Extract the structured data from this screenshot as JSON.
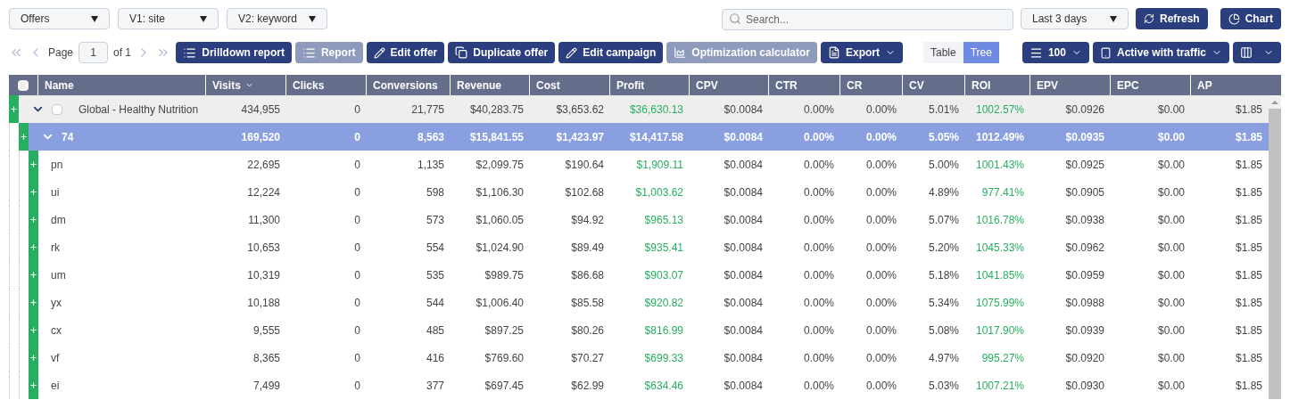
{
  "filters": [
    {
      "value": "Offers"
    },
    {
      "value": "V1: site"
    },
    {
      "value": "V2: keyword"
    }
  ],
  "search": {
    "placeholder": "Search..."
  },
  "date_range": {
    "value": "Last 3 days"
  },
  "top_buttons": [
    {
      "kind": "refresh",
      "label": "Refresh"
    },
    {
      "kind": "chart",
      "label": "Chart"
    }
  ],
  "pagination": {
    "label": "Page",
    "page": "1",
    "total": "of 1"
  },
  "actions": [
    {
      "kind": "list",
      "label": "Drilldown report",
      "disabled": false
    },
    {
      "kind": "list",
      "label": "Report",
      "disabled": true
    },
    {
      "kind": "edit",
      "label": "Edit offer",
      "disabled": false
    },
    {
      "kind": "copy",
      "label": "Duplicate offer",
      "disabled": false
    },
    {
      "kind": "edit",
      "label": "Edit campaign",
      "disabled": false
    },
    {
      "kind": "calc",
      "label": "Optimization calculator",
      "disabled": true
    },
    {
      "kind": "export",
      "label": "Export",
      "disabled": false
    }
  ],
  "view_toggle": [
    {
      "label": "Table",
      "selected": false
    },
    {
      "label": "Tree",
      "selected": true
    }
  ],
  "right_controls": [
    {
      "kind": "rows",
      "label": "100"
    },
    {
      "kind": "filter",
      "label": "Active with traffic"
    },
    {
      "kind": "columns"
    }
  ],
  "table": {
    "select_all": {
      "checked": false
    },
    "columns": [
      {
        "label": "Name",
        "kind": "text"
      },
      {
        "label": "Visits",
        "kind": "metric",
        "sorted": true
      },
      {
        "label": "Clicks",
        "kind": "metric"
      },
      {
        "label": "Conversions",
        "kind": "metric"
      },
      {
        "label": "Revenue",
        "kind": "metric"
      },
      {
        "label": "Cost",
        "kind": "metric"
      },
      {
        "label": "Profit",
        "kind": "gain"
      },
      {
        "label": "CPV",
        "kind": "metric"
      },
      {
        "label": "CTR",
        "kind": "metric"
      },
      {
        "label": "CR",
        "kind": "metric"
      },
      {
        "label": "CV",
        "kind": "metric"
      },
      {
        "label": "ROI",
        "kind": "gain"
      },
      {
        "label": "EPV",
        "kind": "metric"
      },
      {
        "label": "EPC",
        "kind": "metric"
      },
      {
        "label": "AP",
        "kind": "metric"
      }
    ],
    "rows": [
      {
        "kind": "group",
        "expanded": true,
        "selected": false,
        "checked": false,
        "cells": [
          "Global - Healthy Nutrition",
          "434,955",
          "0",
          "21,775",
          "$40,283.75",
          "$3,653.62",
          "$36,630.13",
          "$0.0084",
          "0.00%",
          "0.00%",
          "5.01%",
          "1002.57%",
          "$0.0926",
          "$0.00",
          "$1.85"
        ],
        "children": [
          {
            "kind": "subgroup",
            "expanded": true,
            "selected": true,
            "cells": [
              "74",
              "169,520",
              "0",
              "8,563",
              "$15,841.55",
              "$1,423.97",
              "$14,417.58",
              "$0.0084",
              "0.00%",
              "0.00%",
              "5.05%",
              "1012.49%",
              "$0.0935",
              "$0.00",
              "$1.85"
            ],
            "children": [
              {
                "kind": "leaf",
                "selected": false,
                "cells": [
                  "pn",
                  "22,695",
                  "0",
                  "1,135",
                  "$2,099.75",
                  "$190.64",
                  "$1,909.11",
                  "$0.0084",
                  "0.00%",
                  "0.00%",
                  "5.00%",
                  "1001.43%",
                  "$0.0925",
                  "$0.00",
                  "$1.85"
                ]
              },
              {
                "kind": "leaf",
                "selected": false,
                "cells": [
                  "ui",
                  "12,224",
                  "0",
                  "598",
                  "$1,106.30",
                  "$102.68",
                  "$1,003.62",
                  "$0.0084",
                  "0.00%",
                  "0.00%",
                  "4.89%",
                  "977.41%",
                  "$0.0905",
                  "$0.00",
                  "$1.85"
                ]
              },
              {
                "kind": "leaf",
                "selected": false,
                "cells": [
                  "dm",
                  "11,300",
                  "0",
                  "573",
                  "$1,060.05",
                  "$94.92",
                  "$965.13",
                  "$0.0084",
                  "0.00%",
                  "0.00%",
                  "5.07%",
                  "1016.78%",
                  "$0.0938",
                  "$0.00",
                  "$1.85"
                ]
              },
              {
                "kind": "leaf",
                "selected": false,
                "cells": [
                  "rk",
                  "10,653",
                  "0",
                  "554",
                  "$1,024.90",
                  "$89.49",
                  "$935.41",
                  "$0.0084",
                  "0.00%",
                  "0.00%",
                  "5.20%",
                  "1045.33%",
                  "$0.0962",
                  "$0.00",
                  "$1.85"
                ]
              },
              {
                "kind": "leaf",
                "selected": false,
                "cells": [
                  "um",
                  "10,319",
                  "0",
                  "535",
                  "$989.75",
                  "$86.68",
                  "$903.07",
                  "$0.0084",
                  "0.00%",
                  "0.00%",
                  "5.18%",
                  "1041.85%",
                  "$0.0959",
                  "$0.00",
                  "$1.85"
                ]
              },
              {
                "kind": "leaf",
                "selected": false,
                "cells": [
                  "yx",
                  "10,188",
                  "0",
                  "544",
                  "$1,006.40",
                  "$85.58",
                  "$920.82",
                  "$0.0084",
                  "0.00%",
                  "0.00%",
                  "5.34%",
                  "1075.99%",
                  "$0.0988",
                  "$0.00",
                  "$1.85"
                ]
              },
              {
                "kind": "leaf",
                "selected": false,
                "cells": [
                  "cx",
                  "9,555",
                  "0",
                  "485",
                  "$897.25",
                  "$80.26",
                  "$816.99",
                  "$0.0084",
                  "0.00%",
                  "0.00%",
                  "5.08%",
                  "1017.90%",
                  "$0.0939",
                  "$0.00",
                  "$1.85"
                ]
              },
              {
                "kind": "leaf",
                "selected": false,
                "cells": [
                  "vf",
                  "8,365",
                  "0",
                  "416",
                  "$769.60",
                  "$70.27",
                  "$699.33",
                  "$0.0084",
                  "0.00%",
                  "0.00%",
                  "4.97%",
                  "995.27%",
                  "$0.0920",
                  "$0.00",
                  "$1.85"
                ]
              },
              {
                "kind": "leaf",
                "selected": false,
                "cells": [
                  "ei",
                  "7,499",
                  "0",
                  "377",
                  "$697.45",
                  "$62.99",
                  "$634.46",
                  "$0.0084",
                  "0.00%",
                  "0.00%",
                  "5.03%",
                  "1007.21%",
                  "$0.0930",
                  "$0.00",
                  "$1.85"
                ]
              }
            ]
          }
        ]
      }
    ]
  }
}
